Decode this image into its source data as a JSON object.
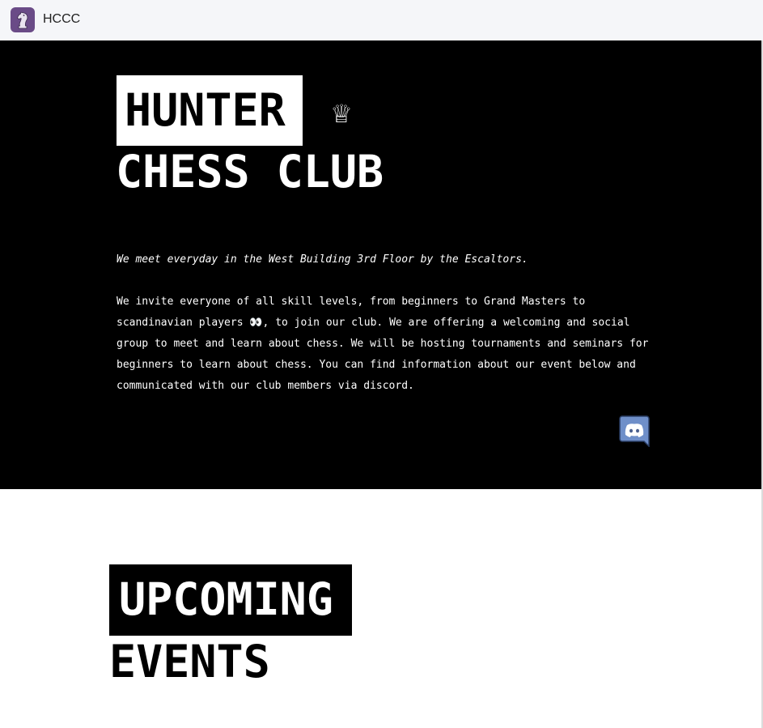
{
  "header": {
    "site_name": "HCCC",
    "logo_icon": "chess-knight-icon",
    "logo_color": "#6a4b87"
  },
  "hero": {
    "title_line1": "HUNTER",
    "title_line2": "CHESS CLUB",
    "crown_glyph": "♕",
    "crown_icon": "crown-icon",
    "meeting_note": "We meet everyday in the West Building 3rd Floor by the Escaltors.",
    "invite_text": "We invite everyone of all skill levels, from beginners to Grand Masters to scandinavian players 👀, to join our club. We are offering a welcoming and social group to meet and learn about chess. We will be hosting tournaments and seminars for beginners to learn about chess. You can find information about our event below and communicated with our club members via discord.",
    "discord_icon": "discord-icon",
    "discord_color": "#7289da"
  },
  "events_section": {
    "title_line1": "UPCOMING",
    "title_line2": "EVENTS"
  }
}
